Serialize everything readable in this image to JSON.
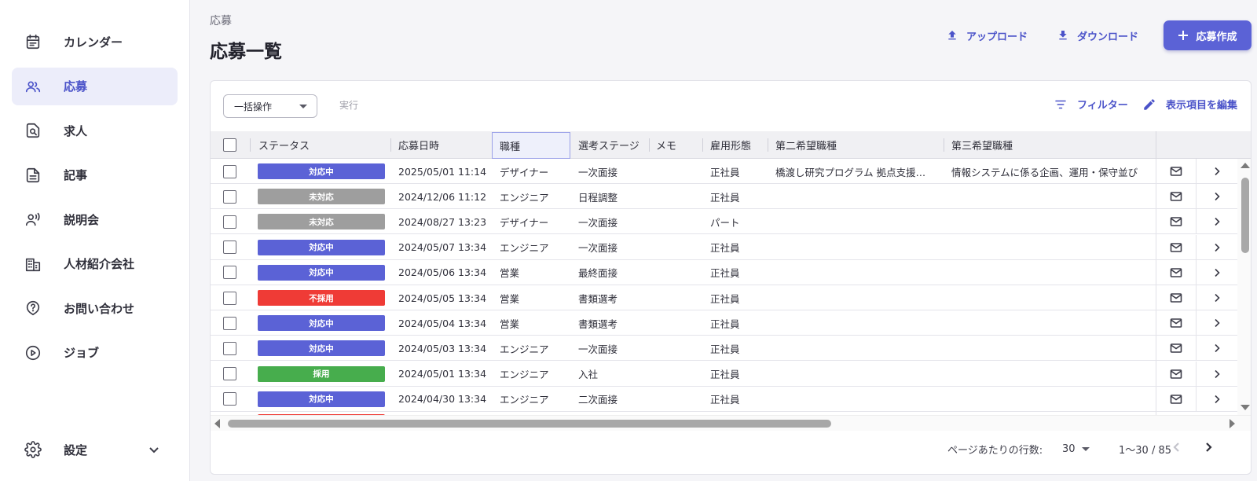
{
  "sidebar": {
    "items": [
      {
        "label": "カレンダー",
        "icon": "calendar-icon",
        "active": false
      },
      {
        "label": "応募",
        "icon": "people-icon",
        "active": true
      },
      {
        "label": "求人",
        "icon": "job-search-icon",
        "active": false
      },
      {
        "label": "記事",
        "icon": "document-icon",
        "active": false
      },
      {
        "label": "説明会",
        "icon": "presenter-icon",
        "active": false
      },
      {
        "label": "人材紹介会社",
        "icon": "building-icon",
        "active": false
      },
      {
        "label": "お問い合わせ",
        "icon": "help-icon",
        "active": false
      },
      {
        "label": "ジョブ",
        "icon": "play-circle-icon",
        "active": false
      }
    ],
    "settings": {
      "label": "設定",
      "icon": "gear-icon"
    }
  },
  "header": {
    "breadcrumb": "応募",
    "title": "応募一覧",
    "upload_label": "アップロード",
    "download_label": "ダウンロード",
    "create_label": "応募作成"
  },
  "toolbar": {
    "bulk_action": "一括操作",
    "execute": "実行",
    "filter": "フィルター",
    "edit_columns": "表示項目を編集"
  },
  "table": {
    "columns": [
      "ステータス",
      "応募日時",
      "職種",
      "選考ステージ",
      "メモ",
      "雇用形態",
      "第二希望職種",
      "第三希望職種"
    ],
    "rows": [
      {
        "status": "対応中",
        "status_color": "#5b62d6",
        "date": "2025/05/01 11:14",
        "job": "デザイナー",
        "stage": "一次面接",
        "memo": "",
        "employment": "正社員",
        "second": "橋渡し研究プログラム 拠点支援…",
        "third": "情報システムに係る企画、運用・保守並び"
      },
      {
        "status": "未対応",
        "status_color": "#9e9e9e",
        "date": "2024/12/06 11:12",
        "job": "エンジニア",
        "stage": "日程調整",
        "memo": "",
        "employment": "正社員",
        "second": "",
        "third": ""
      },
      {
        "status": "未対応",
        "status_color": "#9e9e9e",
        "date": "2024/08/27 13:23",
        "job": "デザイナー",
        "stage": "一次面接",
        "memo": "",
        "employment": "パート",
        "second": "",
        "third": ""
      },
      {
        "status": "対応中",
        "status_color": "#5b62d6",
        "date": "2024/05/07 13:34",
        "job": "エンジニア",
        "stage": "一次面接",
        "memo": "",
        "employment": "正社員",
        "second": "",
        "third": ""
      },
      {
        "status": "対応中",
        "status_color": "#5b62d6",
        "date": "2024/05/06 13:34",
        "job": "営業",
        "stage": "最終面接",
        "memo": "",
        "employment": "正社員",
        "second": "",
        "third": ""
      },
      {
        "status": "不採用",
        "status_color": "#ef3b36",
        "date": "2024/05/05 13:34",
        "job": "営業",
        "stage": "書類選考",
        "memo": "",
        "employment": "正社員",
        "second": "",
        "third": ""
      },
      {
        "status": "対応中",
        "status_color": "#5b62d6",
        "date": "2024/05/04 13:34",
        "job": "営業",
        "stage": "書類選考",
        "memo": "",
        "employment": "正社員",
        "second": "",
        "third": ""
      },
      {
        "status": "対応中",
        "status_color": "#5b62d6",
        "date": "2024/05/03 13:34",
        "job": "エンジニア",
        "stage": "一次面接",
        "memo": "",
        "employment": "正社員",
        "second": "",
        "third": ""
      },
      {
        "status": "採用",
        "status_color": "#47ad4d",
        "date": "2024/05/01 13:34",
        "job": "エンジニア",
        "stage": "入社",
        "memo": "",
        "employment": "正社員",
        "second": "",
        "third": ""
      },
      {
        "status": "対応中",
        "status_color": "#5b62d6",
        "date": "2024/04/30 13:34",
        "job": "エンジニア",
        "stage": "二次面接",
        "memo": "",
        "employment": "正社員",
        "second": "",
        "third": ""
      }
    ],
    "partial_row_status_color": "#ef3b36"
  },
  "pagination": {
    "rows_per_page_label": "ページあたりの行数:",
    "rows_per_page": "30",
    "range": "1〜30 / 85"
  },
  "colors": {
    "accent": "#4b53c9",
    "primary_button": "#5b62d6",
    "active_nav_bg": "#ecedfa"
  }
}
